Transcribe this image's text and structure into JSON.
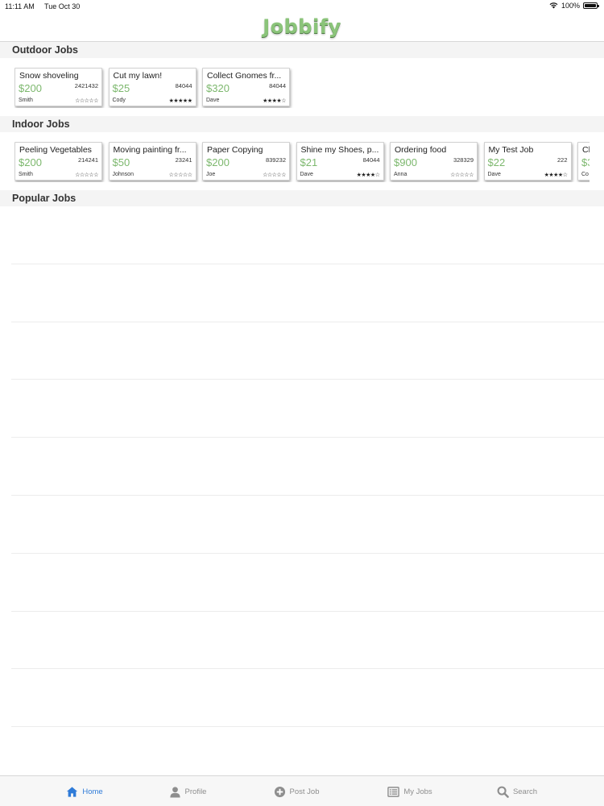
{
  "status_bar": {
    "time": "11:11 AM",
    "date": "Tue Oct 30",
    "battery": "100%",
    "battery_level": 1.0
  },
  "app": {
    "title": "Jobbify"
  },
  "sections": {
    "outdoor": {
      "title": "Outdoor Jobs"
    },
    "indoor": {
      "title": "Indoor Jobs"
    },
    "popular": {
      "title": "Popular Jobs"
    }
  },
  "outdoor_jobs": [
    {
      "title": "Snow shoveling",
      "price": "$200",
      "zip": "2421432",
      "user": "Smith",
      "stars": "☆☆☆☆☆"
    },
    {
      "title": "Cut my lawn!",
      "price": "$25",
      "zip": "84044",
      "user": "Cody",
      "stars": "★★★★★"
    },
    {
      "title": "Collect Gnomes fr...",
      "price": "$320",
      "zip": "84044",
      "user": "Dave",
      "stars": "★★★★☆"
    }
  ],
  "indoor_jobs": [
    {
      "title": "Peeling Vegetables",
      "price": "$200",
      "zip": "214241",
      "user": "Smith",
      "stars": "☆☆☆☆☆"
    },
    {
      "title": "Moving painting fr...",
      "price": "$50",
      "zip": "23241",
      "user": "Johnson",
      "stars": "☆☆☆☆☆"
    },
    {
      "title": "Paper Copying",
      "price": "$200",
      "zip": "839232",
      "user": "Joe",
      "stars": "☆☆☆☆☆"
    },
    {
      "title": "Shine my Shoes, p...",
      "price": "$21",
      "zip": "84044",
      "user": "Dave",
      "stars": "★★★★☆"
    },
    {
      "title": "Ordering food",
      "price": "$900",
      "zip": "328329",
      "user": "Anna",
      "stars": "☆☆☆☆☆"
    },
    {
      "title": "My Test Job",
      "price": "$22",
      "zip": "222",
      "user": "Dave",
      "stars": "★★★★☆"
    },
    {
      "title": "Cl",
      "price": "$3",
      "zip": "",
      "user": "Co",
      "stars": ""
    }
  ],
  "tabs": [
    {
      "label": "Home",
      "icon": "home-icon",
      "active": true
    },
    {
      "label": "Profile",
      "icon": "profile-icon",
      "active": false
    },
    {
      "label": "Post Job",
      "icon": "plus-circle-icon",
      "active": false
    },
    {
      "label": "My Jobs",
      "icon": "list-icon",
      "active": false
    },
    {
      "label": "Search",
      "icon": "search-icon",
      "active": false
    }
  ],
  "colors": {
    "brand_green": "#8bc47a",
    "price_green": "#7db86e",
    "active_tab": "#2f7bd8",
    "inactive_tab": "#8e8e8e"
  }
}
